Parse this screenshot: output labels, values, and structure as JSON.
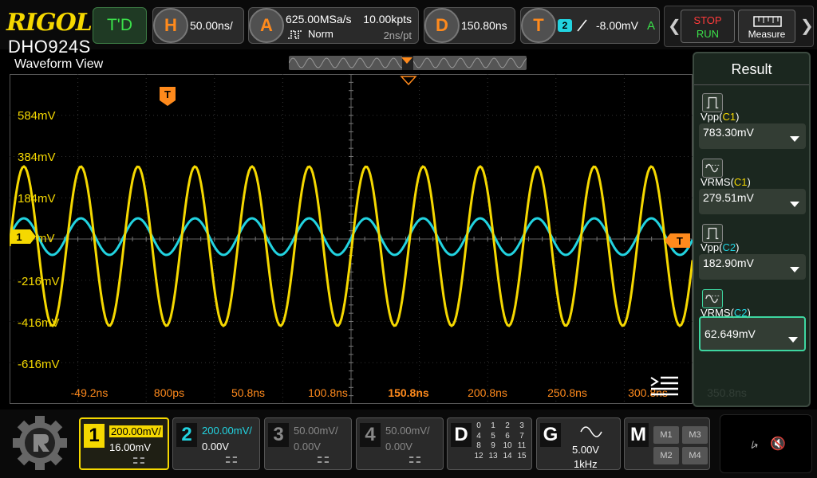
{
  "brand": {
    "logo": "RIGOL",
    "model": "DHO924S"
  },
  "topbar": {
    "td_label": "T'D",
    "horizontal": {
      "letter": "H",
      "timebase": "50.00ns/"
    },
    "acquire": {
      "letter": "A",
      "sample_rate": "625.00MSa/s",
      "memory_depth": "10.00kpts",
      "mode": "Norm",
      "resolution": "2ns/pt"
    },
    "delay": {
      "letter": "D",
      "value": "150.80ns"
    },
    "trigger": {
      "letter": "T",
      "source": "2",
      "level": "-8.00mV",
      "status": "A"
    },
    "run_control": {
      "stop": "STOP",
      "run": "RUN"
    },
    "measure_label": "Measure"
  },
  "waveform_view": {
    "title": "Waveform View",
    "y_labels": [
      "584mV",
      "384mV",
      "184mV",
      "mV",
      "-216mV",
      "-416mV",
      "-616mV"
    ],
    "x_labels": [
      "-49.2ns",
      "800ps",
      "50.8ns",
      "100.8ns",
      "150.8ns",
      "200.8ns",
      "250.8ns",
      "300.8ns",
      "350.8ns"
    ],
    "ch1_marker": "1",
    "trigger_marker": "T",
    "trigger_position_marker": "T",
    "colors": {
      "ch1": "#f5d800",
      "ch2": "#22d3e0",
      "trigger": "#ff8a1c"
    }
  },
  "result_panel": {
    "title": "Result",
    "items": [
      {
        "label": "Vpp",
        "channel": "C1",
        "value": "783.30mV"
      },
      {
        "label": "VRMS",
        "channel": "C1",
        "value": "279.51mV"
      },
      {
        "label": "Vpp",
        "channel": "C2",
        "value": "182.90mV"
      },
      {
        "label": "VRMS",
        "channel": "C2",
        "value": "62.649mV"
      }
    ]
  },
  "bottombar": {
    "channels": [
      {
        "num": "1",
        "scale": "200.00mV/",
        "offset": "16.00mV"
      },
      {
        "num": "2",
        "scale": "200.00mV/",
        "offset": "0.00V"
      },
      {
        "num": "3",
        "scale": "50.00mV/",
        "offset": "0.00V"
      },
      {
        "num": "4",
        "scale": "50.00mV/",
        "offset": "0.00V"
      }
    ],
    "digital": {
      "letter": "D",
      "bits": [
        "0",
        "1",
        "2",
        "3",
        "4",
        "5",
        "6",
        "7",
        "8",
        "9",
        "10",
        "11",
        "12",
        "13",
        "14",
        "15"
      ]
    },
    "generator": {
      "letter": "G",
      "amplitude": "5.00V",
      "frequency": "1kHz"
    },
    "math": {
      "letter": "M",
      "buttons": [
        "M1",
        "M3",
        "M2",
        "M4"
      ]
    }
  }
}
